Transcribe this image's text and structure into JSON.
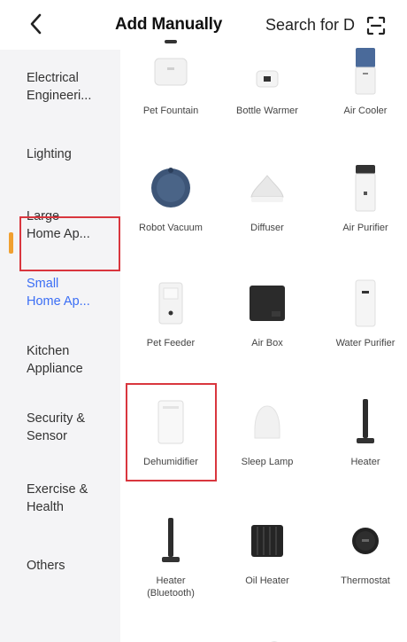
{
  "header": {
    "back_icon": "chevron-left-icon",
    "active_tab": "Add Manually",
    "other_tab": "Search for D",
    "scan_icon": "scan-icon"
  },
  "sidebar": {
    "items": [
      {
        "label": "Electrical\nEngineeri..."
      },
      {
        "label": "Lighting"
      },
      {
        "label": "Large\nHome Ap..."
      },
      {
        "label": "Small\nHome Ap...",
        "selected": true
      },
      {
        "label": "Kitchen\nAppliance"
      },
      {
        "label": "Security &\nSensor"
      },
      {
        "label": "Exercise &\nHealth"
      },
      {
        "label": "Others"
      }
    ]
  },
  "devices": [
    {
      "label": "Pet Fountain",
      "icon": "pet-fountain-icon"
    },
    {
      "label": "Bottle Warmer",
      "icon": "bottle-warmer-icon"
    },
    {
      "label": "Air Cooler",
      "icon": "air-cooler-icon"
    },
    {
      "label": "Robot Vacuum",
      "icon": "robot-vacuum-icon"
    },
    {
      "label": "Diffuser",
      "icon": "diffuser-icon"
    },
    {
      "label": "Air Purifier",
      "icon": "air-purifier-icon"
    },
    {
      "label": "Pet Feeder",
      "icon": "pet-feeder-icon"
    },
    {
      "label": "Air Box",
      "icon": "air-box-icon"
    },
    {
      "label": "Water Purifier",
      "icon": "water-purifier-icon"
    },
    {
      "label": "Dehumidifier",
      "icon": "dehumidifier-icon",
      "highlighted": true
    },
    {
      "label": "Sleep Lamp",
      "icon": "sleep-lamp-icon"
    },
    {
      "label": "Heater",
      "icon": "heater-icon"
    },
    {
      "label": "Heater\n(Bluetooth)",
      "icon": "heater-bluetooth-icon"
    },
    {
      "label": "Oil Heater",
      "icon": "oil-heater-icon"
    },
    {
      "label": "Thermostat",
      "icon": "thermostat-icon"
    }
  ],
  "colors": {
    "selected_category": "#3b6ef5",
    "highlight_border": "#d9363e",
    "sidebar_bg": "#f4f4f6"
  }
}
